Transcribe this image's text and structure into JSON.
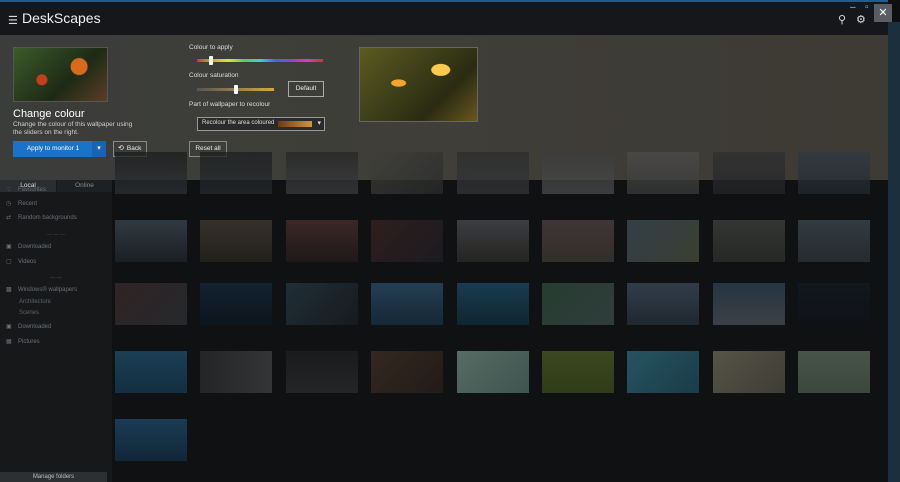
{
  "app": {
    "title": "DeskScapes"
  },
  "titlebar_icons": [
    "search-icon",
    "gear-icon",
    "help-icon"
  ],
  "window_controls": {
    "minimize": "–",
    "maximize": "▫",
    "close": "✕"
  },
  "panel": {
    "heading": "Change colour",
    "description": "Change the colour of this wallpaper using the sliders on the right.",
    "apply_button": "Apply to monitor 1",
    "back_button": "Back",
    "colour_to_apply_label": "Colour to apply",
    "colour_to_apply_value": 0.11,
    "colour_saturation_label": "Colour saturation",
    "colour_saturation_value": 0.5,
    "default_button": "Default",
    "part_label": "Part of wallpaper to recolour",
    "part_select_value": "Recolour the area coloured",
    "reset_button": "Reset all"
  },
  "sidebar": {
    "tabs": [
      "Local",
      "Online"
    ],
    "items": [
      {
        "label": "Favourites",
        "icon": "heart-icon"
      },
      {
        "label": "Recent",
        "icon": "clock-icon"
      },
      {
        "label": "Random backgrounds",
        "icon": "shuffle-icon"
      }
    ],
    "separator_1": "— — —",
    "items_2": [
      {
        "label": "Downloaded",
        "icon": "folder-icon"
      },
      {
        "label": "Videos",
        "icon": "video-icon"
      }
    ],
    "separator_2": "— —",
    "items_3": [
      {
        "label": "Windows® wallpapers",
        "icon": "windows-icon"
      }
    ],
    "sub_items": [
      "Architecture",
      "Scenes"
    ],
    "items_4": [
      {
        "label": "Downloaded",
        "icon": "folder-icon"
      },
      {
        "label": "Pictures",
        "icon": "picture-icon"
      }
    ],
    "manage_button": "Manage folders"
  },
  "colors": {
    "accent": "#1a73c8",
    "panel_bg": "#3e3d39",
    "grid_bg": "#0f1113"
  },
  "tiles": [
    {
      "bg": "linear-gradient(180deg,#1a1c1d,#2d3033)"
    },
    {
      "bg": "linear-gradient(180deg,#1c1e20,#262a2d)"
    },
    {
      "bg": "linear-gradient(180deg,#242526,#3a3c3d)"
    },
    {
      "bg": "linear-gradient(135deg,#3f3f3a,#2a2b2c)"
    },
    {
      "bg": "linear-gradient(180deg,#2b2c2d,#333537)"
    },
    {
      "bg": "linear-gradient(180deg,#3a3b3c,#4a4b4c)"
    },
    {
      "bg": "linear-gradient(180deg,#4c4c4c,#3a3a3a)"
    },
    {
      "bg": "linear-gradient(180deg,#2d2f30,#242527)"
    },
    {
      "bg": "linear-gradient(180deg,#2e3a44,#22292e)"
    },
    {
      "bg": "linear-gradient(180deg,#3b4752,#1f2428)"
    },
    {
      "bg": "linear-gradient(180deg,#413a30,#2a2520)"
    },
    {
      "bg": "linear-gradient(180deg,#4a2f2f,#251b1b)"
    },
    {
      "bg": "linear-gradient(135deg,#3a2222,#1e1e24)"
    },
    {
      "bg": "linear-gradient(180deg,#4a4c50,#2d2b28)"
    },
    {
      "bg": "linear-gradient(180deg,#514044,#3c3a30)"
    },
    {
      "bg": "linear-gradient(135deg,#3d4f58,#4a4c3c)"
    },
    {
      "bg": "linear-gradient(180deg,#3e423c,#2e302c)"
    },
    {
      "bg": "linear-gradient(180deg,#3f4a52,#2c3338)"
    },
    {
      "bg": "linear-gradient(135deg,#3a2a2a,#2c3034)"
    },
    {
      "bg": "linear-gradient(180deg,#14283a,#0c1620)"
    },
    {
      "bg": "linear-gradient(135deg,#253844,#1a1d22)"
    },
    {
      "bg": "linear-gradient(180deg,#2a4e6a,#173040)"
    },
    {
      "bg": "linear-gradient(180deg,#1d4a64,#112c3c)"
    },
    {
      "bg": "linear-gradient(135deg,#2e4a3a,#3a4c48)"
    },
    {
      "bg": "linear-gradient(180deg,#3c4c5c,#25303a)"
    },
    {
      "bg": "linear-gradient(180deg,#2c4052,#4a5058)"
    },
    {
      "bg": "linear-gradient(180deg,#141a22,#0e1218)"
    },
    {
      "bg": "linear-gradient(180deg,#1e4e6a,#153a50)"
    },
    {
      "bg": "linear-gradient(90deg,#2a2c2e,#3e4042)"
    },
    {
      "bg": "linear-gradient(180deg,#1c1e20,#2a2c2e)"
    },
    {
      "bg": "linear-gradient(135deg,#3e3024,#2a1e1a)"
    },
    {
      "bg": "linear-gradient(135deg,#6e8a7e,#4e6a62)"
    },
    {
      "bg": "linear-gradient(180deg,#4c5a24,#3a4a1c)"
    },
    {
      "bg": "linear-gradient(135deg,#2e6a7a,#1e4a5a)"
    },
    {
      "bg": "linear-gradient(135deg,#6e6a58,#4e4c40)"
    },
    {
      "bg": "linear-gradient(180deg,#5a6a5c,#4a5a4c)"
    },
    {
      "bg": "linear-gradient(180deg,#1e4a6a,#132e44)"
    }
  ]
}
